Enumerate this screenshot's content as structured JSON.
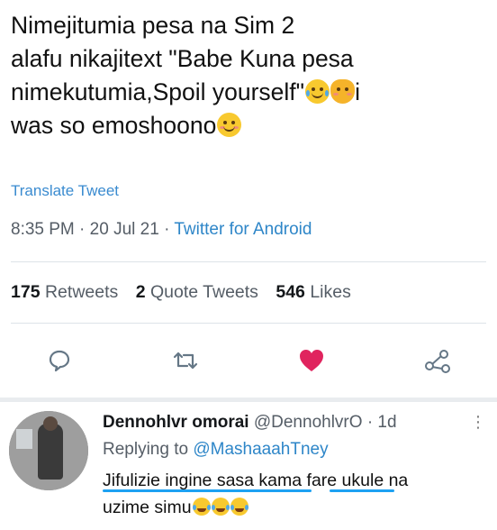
{
  "tweet": {
    "lines": [
      "Nimejitumia pesa na Sim 2",
      "alafu nikajitext \"Babe Kuna pesa",
      "nimekutumia,Spoil yourself\"",
      "was so emoshoono"
    ],
    "line3_tail": "i",
    "translate_label": "Translate Tweet",
    "time": "8:35 PM",
    "date": "20 Jul 21",
    "source": "Twitter for Android",
    "dot": "·"
  },
  "stats": {
    "retweets_count": "175",
    "retweets_label": "Retweets",
    "quotes_count": "2",
    "quotes_label": "Quote Tweets",
    "likes_count": "546",
    "likes_label": "Likes"
  },
  "actions": [
    {
      "icon": "reply-icon"
    },
    {
      "icon": "retweet-icon"
    },
    {
      "icon": "heart-icon",
      "color": "#e0245e",
      "liked": true
    },
    {
      "icon": "share-icon"
    }
  ],
  "reply": {
    "name": "Dennohlvr omorai",
    "handle": "@DennohlvrO",
    "dot": "·",
    "time": "1d",
    "more": "⋮",
    "replying_label": "Replying to",
    "replying_to": "@MashaaahTney",
    "text_line1": "Jifulizie ingine sasa kama fare ukule na",
    "text_line2": "uzime simu"
  },
  "colors": {
    "link": "#2e86c8",
    "heart": "#e0245e",
    "underline": "#1da1f2",
    "muted": "#555d66"
  }
}
